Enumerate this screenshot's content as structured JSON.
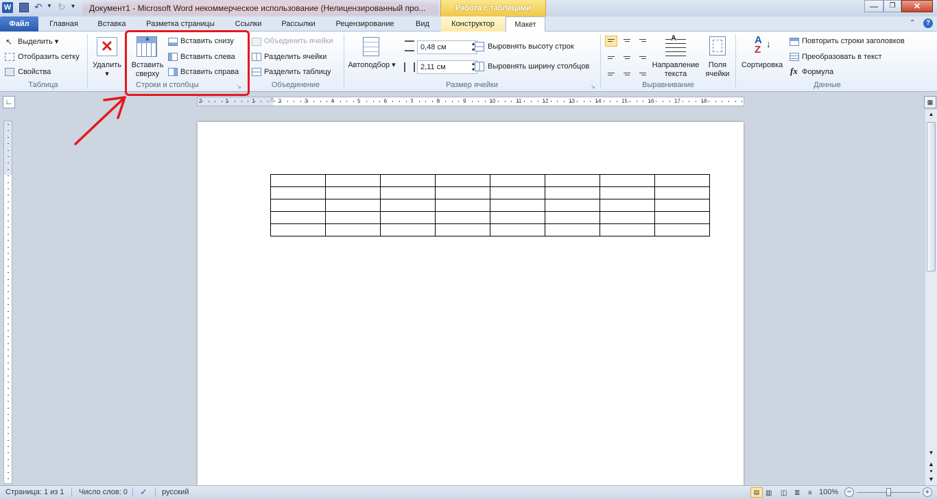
{
  "window": {
    "title": "Документ1  -  Microsoft Word некоммерческое использование (Нелицензированный про...",
    "context_tab_group": "Работа с таблицами"
  },
  "tabs": [
    {
      "label": "Файл"
    },
    {
      "label": "Главная"
    },
    {
      "label": "Вставка"
    },
    {
      "label": "Разметка страницы"
    },
    {
      "label": "Ссылки"
    },
    {
      "label": "Рассылки"
    },
    {
      "label": "Рецензирование"
    },
    {
      "label": "Вид"
    },
    {
      "label": "Конструктор"
    },
    {
      "label": "Макет"
    }
  ],
  "ribbon": {
    "table": {
      "label": "Таблица",
      "select": "Выделить",
      "show_grid": "Отобразить сетку",
      "properties": "Свойства"
    },
    "rows_cols": {
      "label": "Строки и столбцы",
      "delete": "Удалить",
      "insert_above": "Вставить сверху",
      "insert_below": "Вставить снизу",
      "insert_left": "Вставить слева",
      "insert_right": "Вставить справа"
    },
    "merge": {
      "label": "Объединение",
      "merge_cells": "Объединить ячейки",
      "split_cells": "Разделить ячейки",
      "split_table": "Разделить таблицу"
    },
    "cell_size": {
      "label": "Размер ячейки",
      "autofit": "Автоподбор",
      "height_value": "0,48 см",
      "width_value": "2,11 см",
      "distribute_rows": "Выровнять высоту строк",
      "distribute_cols": "Выровнять ширину столбцов"
    },
    "alignment": {
      "label": "Выравнивание",
      "text_direction": "Направление текста",
      "cell_margins": "Поля ячейки"
    },
    "data": {
      "label": "Данные",
      "sort": "Сортировка",
      "repeat_header": "Повторить строки заголовков",
      "convert_text": "Преобразовать в текст",
      "formula": "Формула"
    }
  },
  "ruler": {
    "labels": [
      "2",
      "1",
      "1",
      "2",
      "3",
      "4",
      "5",
      "6",
      "7",
      "8",
      "9",
      "10",
      "11",
      "12",
      "13",
      "14",
      "15",
      "16",
      "17",
      "18"
    ]
  },
  "document": {
    "table_rows": 5,
    "table_cols": 8
  },
  "status": {
    "page": "Страница: 1 из 1",
    "words": "Число слов: 0",
    "language": "русский",
    "zoom": "100%"
  },
  "colors": {
    "highlight": "#e3191c",
    "file_tab": "#2a5caf",
    "context": "#f3d35e"
  }
}
